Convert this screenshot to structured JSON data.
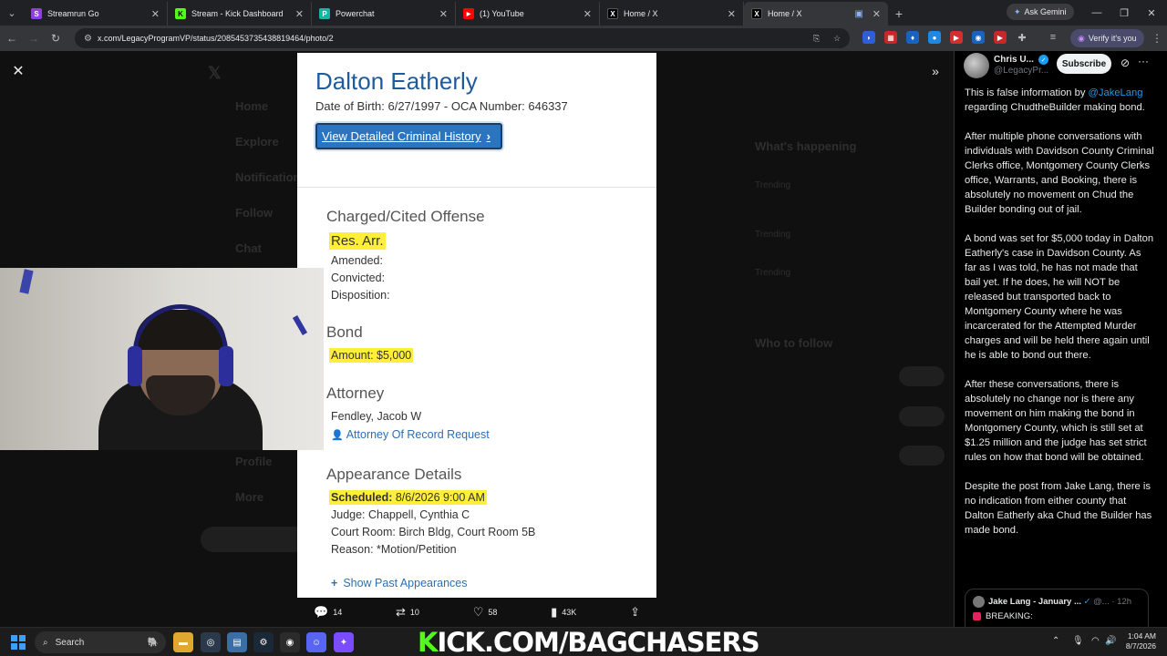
{
  "browser": {
    "tabs": [
      {
        "title": "Streamrun Go",
        "favicon": "S",
        "favicon_color": "#8e3fe0"
      },
      {
        "title": "Stream - Kick Dashboard",
        "favicon": "K",
        "favicon_color": "#53fc18"
      },
      {
        "title": "Powerchat",
        "favicon": "P",
        "favicon_color": "#19b4a6"
      },
      {
        "title": "(1) YouTube",
        "favicon": "▶",
        "favicon_color": "#ff0000"
      },
      {
        "title": "Home / X",
        "favicon": "X",
        "favicon_color": "#000000"
      },
      {
        "title": "Home / X",
        "favicon": "X",
        "favicon_color": "#000000",
        "active": true
      }
    ],
    "ask_gemini": "Ask Gemini",
    "url": "x.com/LegacyProgramVP/status/2085453735438819464/photo/2",
    "verify_label": "Verify it's you"
  },
  "record": {
    "name": "Dalton Eatherly",
    "dob_line": "Date of Birth: 6/27/1997 - OCA Number: 646337",
    "history_button": "View Detailed Criminal History",
    "charged_heading": "Charged/Cited Offense",
    "offense": "Res. Arr.",
    "amended": "Amended:",
    "convicted": "Convicted:",
    "disposition": "Disposition:",
    "bond_heading": "Bond",
    "bond_amount": "Amount: $5,000",
    "attorney_heading": "Attorney",
    "attorney_name": "Fendley, Jacob W",
    "attorney_link": "Attorney Of Record Request",
    "appearance_heading": "Appearance Details",
    "scheduled_label": "Scheduled:",
    "scheduled_value": "8/6/2026 9:00 AM",
    "judge": "Judge: Chappell, Cynthia C",
    "court_room": "Court Room: Birch Bldg, Court Room 5B",
    "reason": "Reason: *Motion/Petition",
    "show_past": "Show Past Appearances"
  },
  "engagement": {
    "replies": "14",
    "reposts": "10",
    "likes": "58",
    "views": "43K"
  },
  "post": {
    "author": "Chris U...",
    "handle": "@LegacyPr...",
    "subscribe": "Subscribe",
    "mention": "@JakeLang",
    "p1_before": "This is false information by ",
    "p1_after": " regarding ChudtheBuilder making bond.",
    "p2": "After multiple phone conversations with individuals with Davidson County Criminal Clerks office, Montgomery County Clerks office, Warrants, and Booking, there is absolutely no movement on Chud the Builder bonding out of jail.",
    "p3": "A bond was set for $5,000 today in Dalton Eatherly's case in Davidson County. As far as I was told, he has not made that bail yet. If he does, he will NOT be released but transported back to Montgomery County where he was incarcerated for the Attempted Murder charges and will be held there again until he is able to bond out there.",
    "p4": "After these conversations, there is absolutely no change nor is there any movement on him making the bond in Montgomery County, which is still set at $1.25 million and the judge has set strict rules on how that bond will be obtained.",
    "p5": "Despite the post from Jake Lang, there is no indication from either county that Dalton Eatherly aka Chud the Builder has made bond.",
    "quote_name": "Jake Lang - January ...",
    "quote_meta": "@... · 12h",
    "quote_text": "BREAKING:"
  },
  "taskbar": {
    "search": "Search",
    "overlay": "ICK.COM/BAGCHASERS",
    "overlay_k": "K",
    "time": "1:04 AM",
    "date": "8/7/2026"
  },
  "colors": {
    "x_blue": "#1d9bf0",
    "record_blue": "#1f5b9c",
    "highlight": "#ffef3a",
    "kick_green": "#53fc18"
  }
}
